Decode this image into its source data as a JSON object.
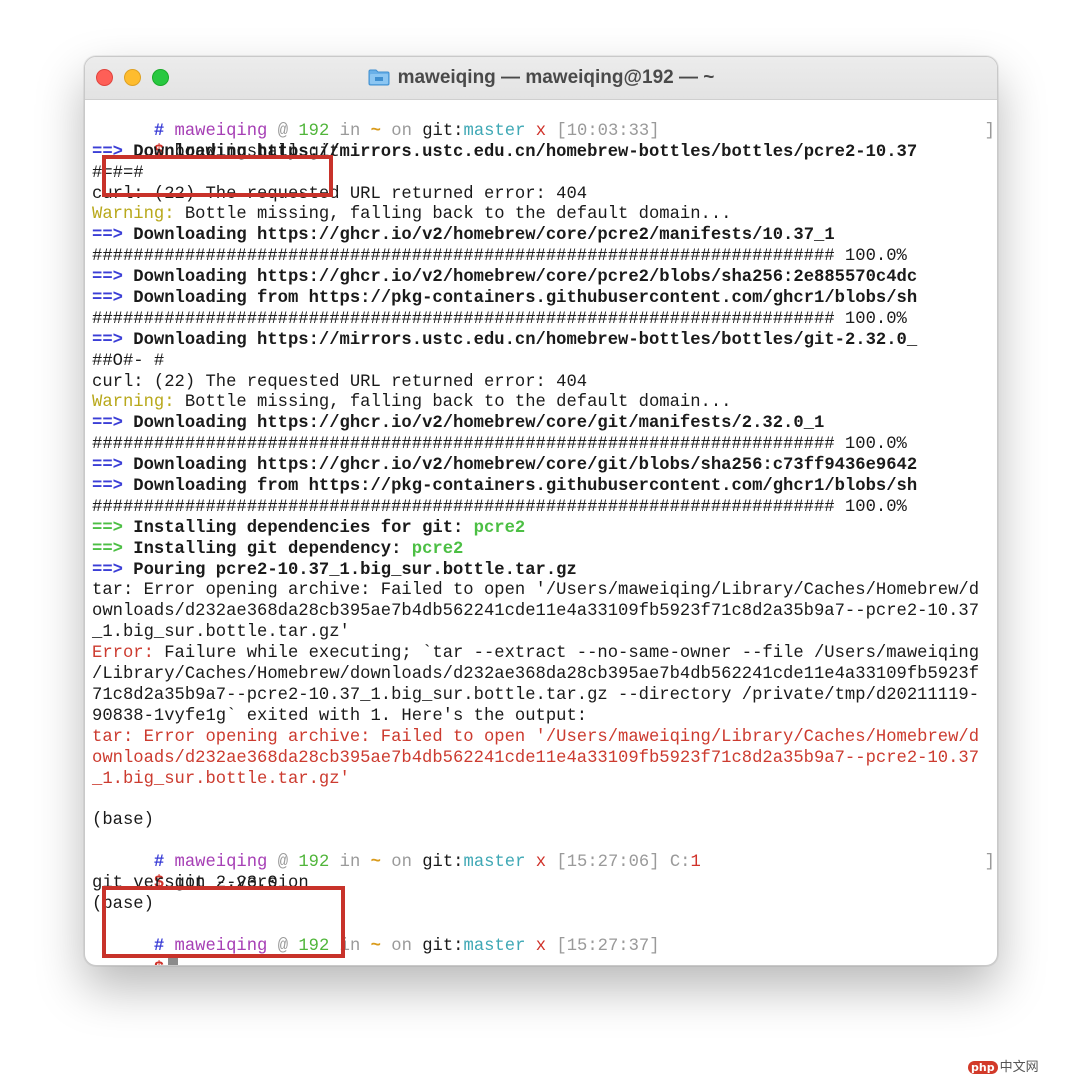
{
  "window": {
    "title": "maweiqing — maweiqing@192 — ~"
  },
  "terminal": {
    "prompt1": {
      "hash": "#",
      "user": "maweiqing",
      "at": "@",
      "host": "192",
      "in": "in",
      "dir": "~",
      "on": "on",
      "git": "git:",
      "branch": "master",
      "dirty": "x",
      "time": "[10:03:33]"
    },
    "cmd1": {
      "dollar": "$",
      "command": "brew install git",
      "bracket": "]"
    },
    "output1": [
      {
        "parts": [
          {
            "cls": "c-blue",
            "t": "==>"
          },
          {
            "cls": "b",
            "t": " Downloading https://mirrors.ustc.edu.cn/homebrew-bottles/bottles/pcre2-10.37"
          }
        ]
      },
      {
        "parts": [
          {
            "cls": "",
            "t": "#=#=#"
          }
        ]
      },
      {
        "parts": [
          {
            "cls": "",
            "t": "curl: (22) The requested URL returned error: 404"
          }
        ]
      },
      {
        "parts": [
          {
            "cls": "c-yellow",
            "t": "Warning:"
          },
          {
            "cls": "",
            "t": " Bottle missing, falling back to the default domain..."
          }
        ]
      },
      {
        "parts": [
          {
            "cls": "c-blue",
            "t": "==>"
          },
          {
            "cls": "b",
            "t": " Downloading https://ghcr.io/v2/homebrew/core/pcre2/manifests/10.37_1"
          }
        ]
      },
      {
        "parts": [
          {
            "cls": "",
            "t": "######################################################################## 100.0%"
          }
        ]
      },
      {
        "parts": [
          {
            "cls": "c-blue",
            "t": "==>"
          },
          {
            "cls": "b",
            "t": " Downloading https://ghcr.io/v2/homebrew/core/pcre2/blobs/sha256:2e885570c4dc"
          }
        ]
      },
      {
        "parts": [
          {
            "cls": "c-blue",
            "t": "==>"
          },
          {
            "cls": "b",
            "t": " Downloading from https://pkg-containers.githubusercontent.com/ghcr1/blobs/sh"
          }
        ]
      },
      {
        "parts": [
          {
            "cls": "",
            "t": "######################################################################## 100.0%"
          }
        ]
      },
      {
        "parts": [
          {
            "cls": "c-blue",
            "t": "==>"
          },
          {
            "cls": "b",
            "t": " Downloading https://mirrors.ustc.edu.cn/homebrew-bottles/bottles/git-2.32.0_"
          }
        ]
      },
      {
        "parts": [
          {
            "cls": "",
            "t": "##O#- #"
          }
        ]
      },
      {
        "parts": [
          {
            "cls": "",
            "t": "curl: (22) The requested URL returned error: 404"
          }
        ]
      },
      {
        "parts": [
          {
            "cls": "c-yellow",
            "t": "Warning:"
          },
          {
            "cls": "",
            "t": " Bottle missing, falling back to the default domain..."
          }
        ]
      },
      {
        "parts": [
          {
            "cls": "c-blue",
            "t": "==>"
          },
          {
            "cls": "b",
            "t": " Downloading https://ghcr.io/v2/homebrew/core/git/manifests/2.32.0_1"
          }
        ]
      },
      {
        "parts": [
          {
            "cls": "",
            "t": "######################################################################## 100.0%"
          }
        ]
      },
      {
        "parts": [
          {
            "cls": "c-blue",
            "t": "==>"
          },
          {
            "cls": "b",
            "t": " Downloading https://ghcr.io/v2/homebrew/core/git/blobs/sha256:c73ff9436e9642"
          }
        ]
      },
      {
        "parts": [
          {
            "cls": "c-blue",
            "t": "==>"
          },
          {
            "cls": "b",
            "t": " Downloading from https://pkg-containers.githubusercontent.com/ghcr1/blobs/sh"
          }
        ]
      },
      {
        "parts": [
          {
            "cls": "",
            "t": "######################################################################## 100.0%"
          }
        ]
      },
      {
        "parts": [
          {
            "cls": "c-bgreen",
            "t": "==>"
          },
          {
            "cls": "b",
            "t": " Installing dependencies for git: "
          },
          {
            "cls": "c-bgreen",
            "t": "pcre2"
          }
        ]
      },
      {
        "parts": [
          {
            "cls": "c-bgreen",
            "t": "==>"
          },
          {
            "cls": "b",
            "t": " Installing git dependency: "
          },
          {
            "cls": "c-bgreen",
            "t": "pcre2"
          }
        ]
      },
      {
        "parts": [
          {
            "cls": "c-blue",
            "t": "==>"
          },
          {
            "cls": "b",
            "t": " Pouring pcre2-10.37_1.big_sur.bottle.tar.gz"
          }
        ]
      },
      {
        "parts": [
          {
            "cls": "",
            "t": "tar: Error opening archive: Failed to open '/Users/maweiqing/Library/Caches/Homebrew/d"
          }
        ]
      },
      {
        "parts": [
          {
            "cls": "",
            "t": "ownloads/d232ae368da28cb395ae7b4db562241cde11e4a33109fb5923f71c8d2a35b9a7--pcre2-10.37"
          }
        ]
      },
      {
        "parts": [
          {
            "cls": "",
            "t": "_1.big_sur.bottle.tar.gz'"
          }
        ]
      },
      {
        "parts": [
          {
            "cls": "c-err",
            "t": "Error:"
          },
          {
            "cls": "",
            "t": " Failure while executing; `tar --extract --no-same-owner --file /Users/maweiqing"
          }
        ]
      },
      {
        "parts": [
          {
            "cls": "",
            "t": "/Library/Caches/Homebrew/downloads/d232ae368da28cb395ae7b4db562241cde11e4a33109fb5923f"
          }
        ]
      },
      {
        "parts": [
          {
            "cls": "",
            "t": "71c8d2a35b9a7--pcre2-10.37_1.big_sur.bottle.tar.gz --directory /private/tmp/d20211119-"
          }
        ]
      },
      {
        "parts": [
          {
            "cls": "",
            "t": "90838-1vyfe1g` exited with 1. Here's the output:"
          }
        ]
      },
      {
        "parts": [
          {
            "cls": "c-err",
            "t": "tar: Error opening archive: Failed to open '/Users/maweiqing/Library/Caches/Homebrew/d"
          }
        ]
      },
      {
        "parts": [
          {
            "cls": "c-err",
            "t": "ownloads/d232ae368da28cb395ae7b4db562241cde11e4a33109fb5923f71c8d2a35b9a7--pcre2-10.37"
          }
        ]
      },
      {
        "parts": [
          {
            "cls": "c-err",
            "t": "_1.big_sur.bottle.tar.gz'"
          }
        ]
      },
      {
        "parts": [
          {
            "cls": "",
            "t": ""
          }
        ]
      },
      {
        "parts": [
          {
            "cls": "",
            "t": "(base)"
          }
        ]
      }
    ],
    "prompt2": {
      "hash": "#",
      "user": "maweiqing",
      "at": "@",
      "host": "192",
      "in": "in",
      "dir": "~",
      "on": "on",
      "git": "git:",
      "branch": "master",
      "dirty": "x",
      "time": "[15:27:06]",
      "code_label": "C:",
      "code": "1"
    },
    "cmd2": {
      "dollar": "$",
      "command": "git --version",
      "bracket": "]"
    },
    "output2": [
      {
        "parts": [
          {
            "cls": "",
            "t": "git version 2.23.0"
          }
        ]
      },
      {
        "parts": [
          {
            "cls": "",
            "t": "(base)"
          }
        ]
      }
    ],
    "prompt3": {
      "hash": "#",
      "user": "maweiqing",
      "at": "@",
      "host": "192",
      "in": "in",
      "dir": "~",
      "on": "on",
      "git": "git:",
      "branch": "master",
      "dirty": "x",
      "time": "[15:27:37]"
    },
    "cmd3": {
      "dollar": "$"
    }
  },
  "watermark": {
    "logo": "php",
    "text": "中文网"
  },
  "colors": {
    "highlight_box": "#c8322a",
    "arrow_blue": "#3b3ed6",
    "arrow_green": "#4cbf44",
    "error_red": "#cc3b2f",
    "warning_yellow": "#b8a81b"
  }
}
